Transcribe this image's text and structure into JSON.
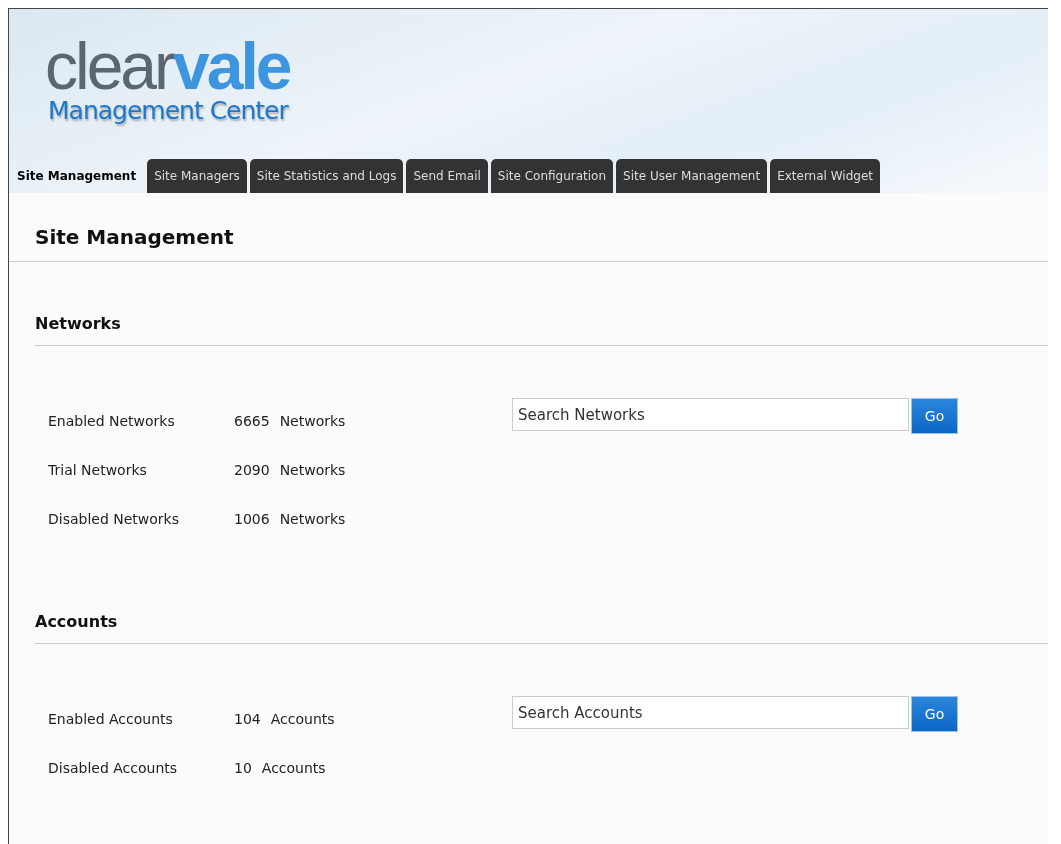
{
  "logo": {
    "word_plain": "clear",
    "word_bold": "vale",
    "subtitle": "Management Center"
  },
  "tabs": [
    {
      "label": "Site Management",
      "selected": true
    },
    {
      "label": "Site Managers",
      "selected": false
    },
    {
      "label": "Site Statistics and Logs",
      "selected": false
    },
    {
      "label": "Send Email",
      "selected": false
    },
    {
      "label": "Site Configuration",
      "selected": false
    },
    {
      "label": "Site User Management",
      "selected": false
    },
    {
      "label": "External Widget",
      "selected": false
    }
  ],
  "page_title": "Site Management",
  "sections": [
    {
      "title": "Networks",
      "rows": [
        {
          "label": "Enabled Networks",
          "count": "6665",
          "unit": "Networks"
        },
        {
          "label": "Trial Networks",
          "count": "2090",
          "unit": "Networks"
        },
        {
          "label": "Disabled Networks",
          "count": "1006",
          "unit": "Networks"
        }
      ],
      "search": {
        "placeholder": "Search Networks",
        "button": "Go"
      }
    },
    {
      "title": "Accounts",
      "rows": [
        {
          "label": "Enabled Accounts",
          "count": "104",
          "unit": "Accounts"
        },
        {
          "label": "Disabled Accounts",
          "count": "10",
          "unit": "Accounts"
        }
      ],
      "search": {
        "placeholder": "Search Accounts",
        "button": "Go"
      }
    }
  ]
}
